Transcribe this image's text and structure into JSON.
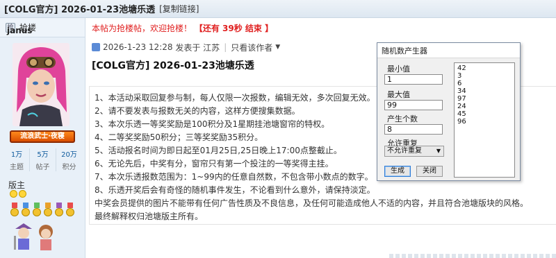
{
  "title": {
    "text": "[COLG官方] 2026-01-23池塘乐透",
    "copy_link": "[复制链接]"
  },
  "sidebar": {
    "sticky_label": "抢楼",
    "username": "janus",
    "rank_badge": "流浪武士·夜寝",
    "stats": [
      {
        "value": "1万",
        "label": "主题"
      },
      {
        "value": "5万",
        "label": "帖子"
      },
      {
        "value": "20万",
        "label": "积分"
      }
    ],
    "role": "版主"
  },
  "notice": {
    "prefix": "本帖为抢楼帖，欢迎抢楼！",
    "countdown": "【还有 39秒 结束 】"
  },
  "post": {
    "date": "2026-1-23 12:28",
    "posted_from": "发表于",
    "location": "江苏",
    "author_only": "只看该作者",
    "heading": "[COLG官方] 2026-01-23池塘乐透",
    "lines": [
      "1、本活动采取回复参与制，每人仅限一次报数，编辑无效，多次回复无效。",
      "2、请不要发表与报数无关的内容，这样方便搜集数据。",
      "3、本次乐透一等奖奖励是100积分及1星期挂池塘窗帘的特权。",
      "4、二等奖奖励50积分；三等奖奖励35积分。",
      "5、活动报名时间为即日起至01月25日,25日晚上17:00点整截止。",
      "6、无论先后，中奖有分，窗帘只有第一个投注的一等奖得主挂。",
      "7、本次乐透报数范围为：1~99内的任意自然数，不包含带小数点的数字。",
      "8、乐透开奖后会有奇怪的随机事件发生，不论看到什么意外，请保持淡定。",
      "中奖会员提供的图片不能带有任何广告性质及不良信息，及任何可能造成他人不适的内容，并且符合池塘版块的风格。",
      "最终解释权归池塘版主所有。"
    ]
  },
  "dialog": {
    "title": "随机数产生器",
    "min_label": "最小值",
    "min_value": "1",
    "max_label": "最大值",
    "max_value": "99",
    "count_label": "产生个数",
    "count_value": "8",
    "repeat_label": "允许重复",
    "repeat_value": "不允许重复",
    "generate_button": "生成",
    "close_button": "关闭",
    "results": [
      "42",
      "3",
      "6",
      "34",
      "97",
      "24",
      "45",
      "96"
    ]
  }
}
